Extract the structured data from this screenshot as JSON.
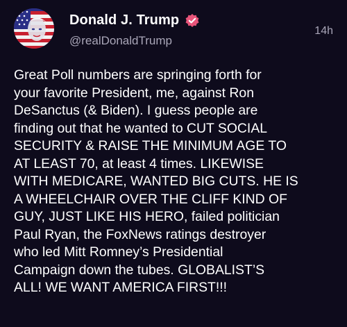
{
  "post": {
    "author_name": "Donald J. Trump",
    "handle": "@realDonaldTrump",
    "timestamp": "14h",
    "verified_icon": "verified-badge-icon",
    "accent_color": "#e8547a",
    "text": "Great Poll numbers are springing forth for\nyour favorite President, me, against Ron\nDeSanctus (& Biden). I guess people are\nfinding out that he wanted to CUT SOCIAL\nSECURITY & RAISE THE MINIMUM AGE TO\nAT LEAST 70, at least 4 times. LIKEWISE\nWITH MEDICARE, WANTED BIG CUTS. HE IS\nA WHEELCHAIR OVER THE CLIFF KIND OF\nGUY, JUST LIKE HIS HERO, failed politician\nPaul Ryan, the FoxNews ratings destroyer\nwho led Mitt Romney’s Presidential\nCampaign down the tubes. GLOBALIST’S\nALL! WE WANT AMERICA FIRST!!!"
  }
}
